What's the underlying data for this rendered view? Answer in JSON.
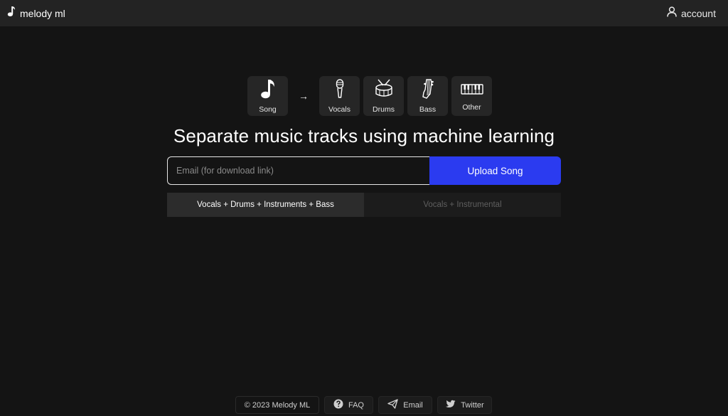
{
  "navbar": {
    "brand": "melody ml",
    "account": "account",
    "icons": {
      "brand": "music-note-icon",
      "account": "user-icon"
    }
  },
  "stems": {
    "source": {
      "label": "Song",
      "icon": "music-note-icon"
    },
    "arrow": "→",
    "outputs": [
      {
        "label": "Vocals",
        "icon": "microphone-icon"
      },
      {
        "label": "Drums",
        "icon": "drum-icon"
      },
      {
        "label": "Bass",
        "icon": "bass-guitar-icon"
      },
      {
        "label": "Other",
        "icon": "keyboard-icon"
      }
    ]
  },
  "headline": "Separate music tracks using machine learning",
  "upload": {
    "email_placeholder": "Email (for download link)",
    "email_value": "",
    "button_label": "Upload Song"
  },
  "modes": {
    "selected": "Vocals + Drums + Instruments + Bass",
    "options": [
      "Vocals + Drums + Instruments + Bass",
      "Vocals + Instrumental"
    ]
  },
  "footer": {
    "copyright": "© 2023 Melody ML",
    "faq": "FAQ",
    "email": "Email",
    "twitter": "Twitter",
    "icons": {
      "faq": "question-circle-icon",
      "email": "paper-plane-icon",
      "twitter": "twitter-bird-icon"
    }
  },
  "colors": {
    "background": "#141414",
    "navbar": "#232323",
    "tile": "#262626",
    "accent": "#2b3bf0",
    "text": "#ffffff",
    "muted": "#5f5f5f"
  }
}
